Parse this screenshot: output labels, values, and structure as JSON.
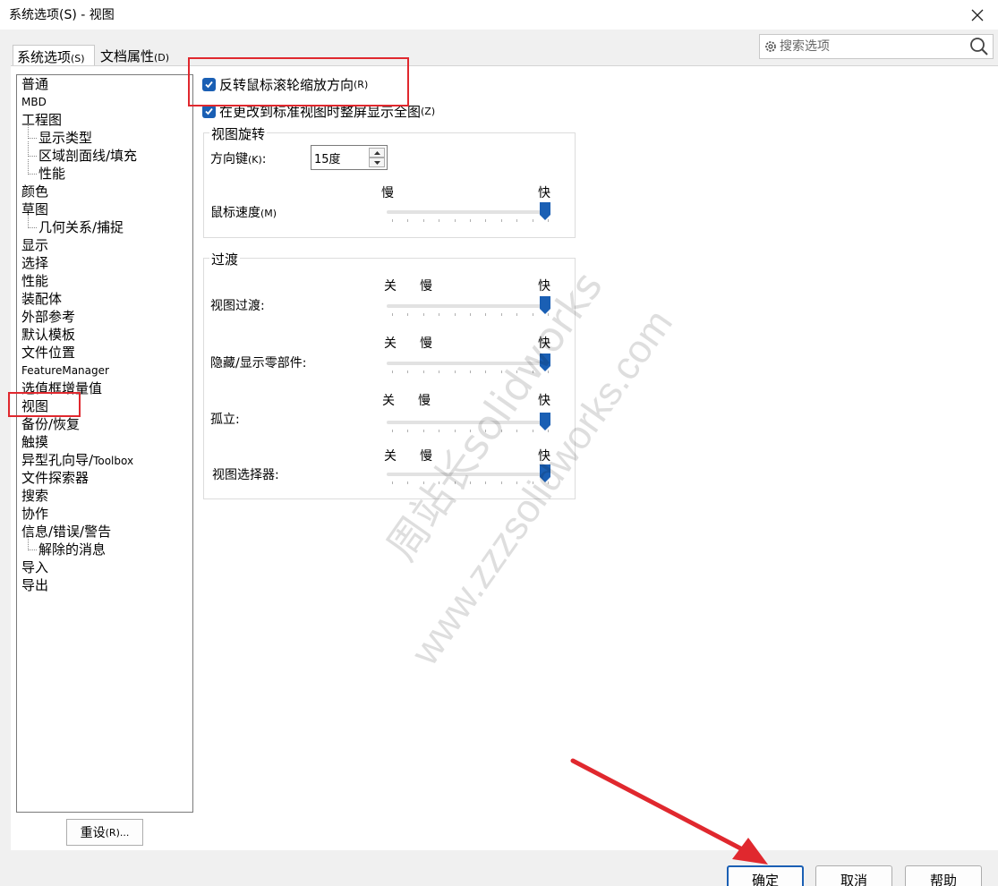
{
  "window": {
    "title": "系统选项(S) - 视图"
  },
  "tabs": [
    {
      "label": "系统选项",
      "accel": "(S)"
    },
    {
      "label": "文档属性",
      "accel": "(D)"
    }
  ],
  "search": {
    "placeholder": "搜索选项"
  },
  "tree": {
    "items": [
      {
        "label": "普通"
      },
      {
        "label": "MBD"
      },
      {
        "label": "工程图"
      },
      {
        "label": "显示类型"
      },
      {
        "label": "区域剖面线/填充"
      },
      {
        "label": "性能"
      },
      {
        "label": "颜色"
      },
      {
        "label": "草图"
      },
      {
        "label": "几何关系/捕捉"
      },
      {
        "label": "显示"
      },
      {
        "label": "选择"
      },
      {
        "label": "性能"
      },
      {
        "label": "装配体"
      },
      {
        "label": "外部参考"
      },
      {
        "label": "默认模板"
      },
      {
        "label": "文件位置"
      },
      {
        "label": "FeatureManager"
      },
      {
        "label": "选值框增量值"
      },
      {
        "label": "视图"
      },
      {
        "label": "备份/恢复"
      },
      {
        "label": "触摸"
      },
      {
        "label": "异型孔向导/",
        "en": "Toolbox"
      },
      {
        "label": "文件探索器"
      },
      {
        "label": "搜索"
      },
      {
        "label": "协作"
      },
      {
        "label": "信息/错误/警告"
      },
      {
        "label": "解除的消息"
      },
      {
        "label": "导入"
      },
      {
        "label": "导出"
      }
    ],
    "selected": "视图"
  },
  "reset_button": {
    "label": "重设",
    "accel": "(R)..."
  },
  "options": {
    "reverse_wheel": {
      "label": "反转鼠标滚轮缩放方向",
      "accel": "(R)",
      "checked": true
    },
    "zoom_to_fit": {
      "label": "在更改到标准视图时整屏显示全图",
      "accel": "(Z)",
      "checked": true
    }
  },
  "rotation_group": {
    "title": "视图旋转",
    "arrow_keys_label": "方向键",
    "arrow_keys_accel": "(K)",
    "arrow_keys_suffix": ":",
    "arrow_keys_value": "15度",
    "mouse_speed_label": "鼠标速度",
    "mouse_speed_accel": "(M)",
    "slow": "慢",
    "fast": "快",
    "mouse_speed_level": 1.0
  },
  "transition_group": {
    "title": "过渡",
    "off": "关",
    "slow": "慢",
    "fast": "快",
    "rows": [
      {
        "label": "视图过渡:",
        "level": 1.0
      },
      {
        "label": "隐藏/显示零部件:",
        "level": 1.0
      },
      {
        "label": "孤立:",
        "level": 1.0
      },
      {
        "label": "视图选择器:",
        "level": 1.0
      }
    ]
  },
  "footer": {
    "ok": "确定",
    "cancel": "取消",
    "help": "帮助"
  },
  "watermark": {
    "line1": "周站长solidworks",
    "line2": "www.zzzsolidworks.com"
  },
  "colors": {
    "accent": "#1a5fb4",
    "annotation": "#e0282e"
  }
}
